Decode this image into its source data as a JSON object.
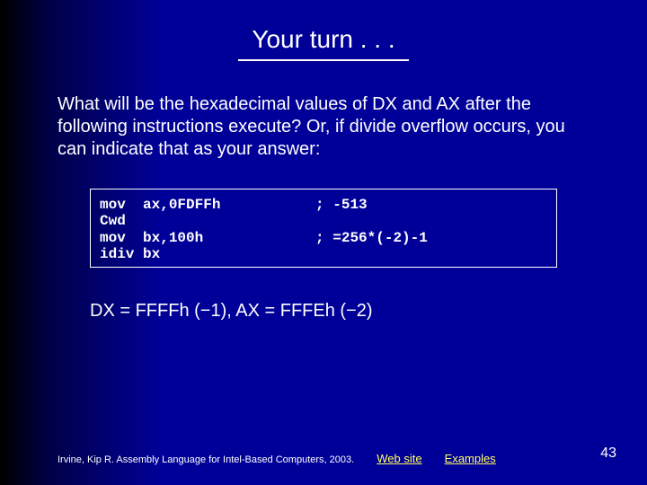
{
  "title": "Your turn . . .",
  "question": "What will be the hexadecimal values of DX and AX after the following instructions execute? Or, if divide overflow occurs, you can indicate that as your answer:",
  "code": "mov  ax,0FDFFh           ; -513\nCwd\nmov  bx,100h             ; =256*(-2)-1\nidiv bx",
  "answer": "DX = FFFFh (−1),  AX = FFFEh (−2)",
  "footer": {
    "citation": "Irvine, Kip R. Assembly Language for Intel-Based Computers, 2003.",
    "link1": "Web site",
    "link2": "Examples"
  },
  "page": "43"
}
